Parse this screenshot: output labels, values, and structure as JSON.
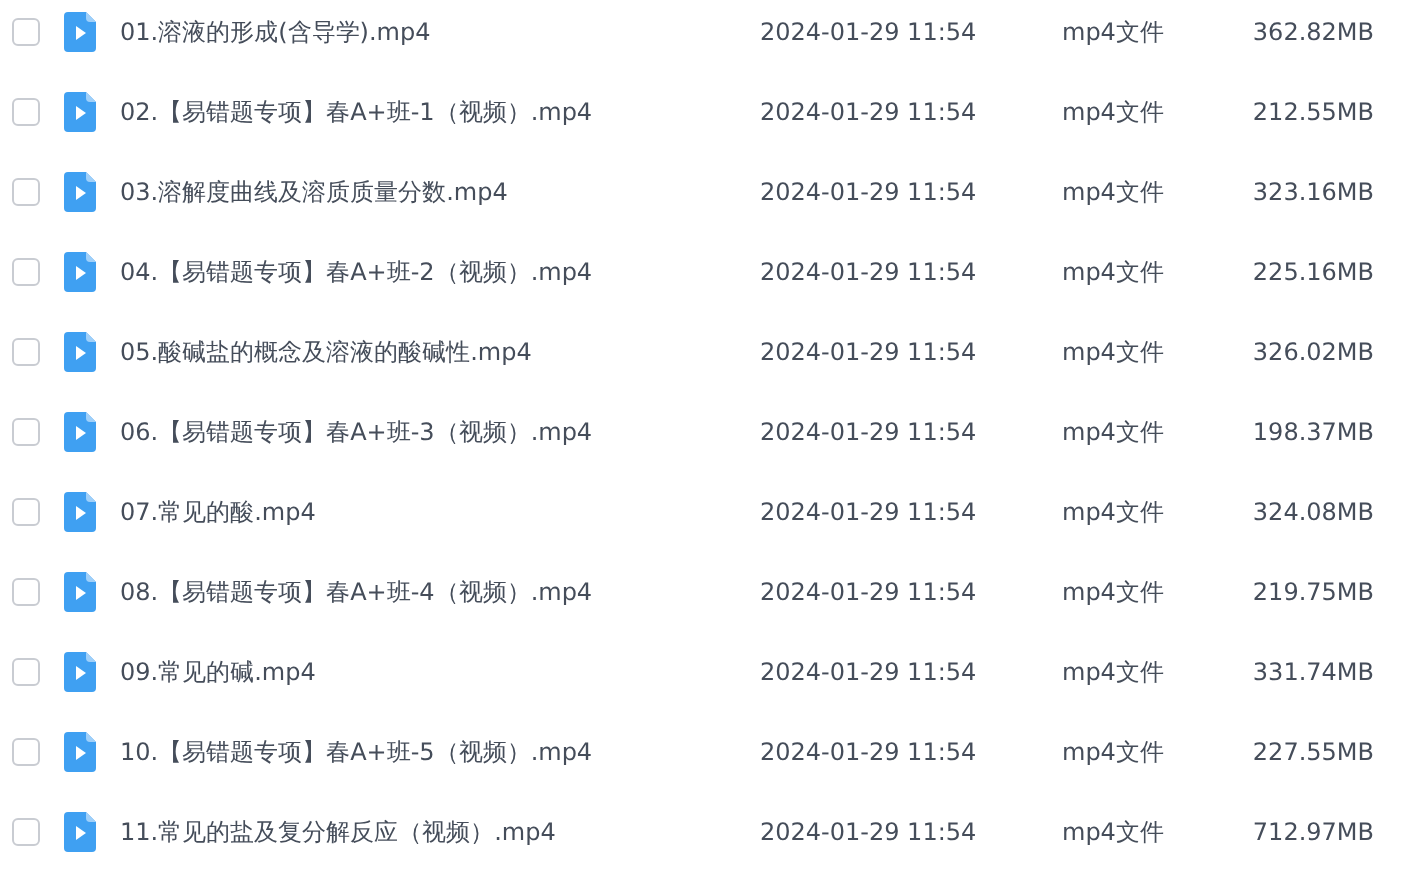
{
  "files": [
    {
      "name": "01.溶液的形成(含导学).mp4",
      "date": "2024-01-29 11:54",
      "type": "mp4文件",
      "size": "362.82MB",
      "checked": false
    },
    {
      "name": "02.【易错题专项】春A+班-1（视频）.mp4",
      "date": "2024-01-29 11:54",
      "type": "mp4文件",
      "size": "212.55MB",
      "checked": false
    },
    {
      "name": "03.溶解度曲线及溶质质量分数.mp4",
      "date": "2024-01-29 11:54",
      "type": "mp4文件",
      "size": "323.16MB",
      "checked": false
    },
    {
      "name": "04.【易错题专项】春A+班-2（视频）.mp4",
      "date": "2024-01-29 11:54",
      "type": "mp4文件",
      "size": "225.16MB",
      "checked": false
    },
    {
      "name": "05.酸碱盐的概念及溶液的酸碱性.mp4",
      "date": "2024-01-29 11:54",
      "type": "mp4文件",
      "size": "326.02MB",
      "checked": false
    },
    {
      "name": "06.【易错题专项】春A+班-3（视频）.mp4",
      "date": "2024-01-29 11:54",
      "type": "mp4文件",
      "size": "198.37MB",
      "checked": false
    },
    {
      "name": "07.常见的酸.mp4",
      "date": "2024-01-29 11:54",
      "type": "mp4文件",
      "size": "324.08MB",
      "checked": false
    },
    {
      "name": "08.【易错题专项】春A+班-4（视频）.mp4",
      "date": "2024-01-29 11:54",
      "type": "mp4文件",
      "size": "219.75MB",
      "checked": false
    },
    {
      "name": "09.常见的碱.mp4",
      "date": "2024-01-29 11:54",
      "type": "mp4文件",
      "size": "331.74MB",
      "checked": false
    },
    {
      "name": "10.【易错题专项】春A+班-5（视频）.mp4",
      "date": "2024-01-29 11:54",
      "type": "mp4文件",
      "size": "227.55MB",
      "checked": false
    },
    {
      "name": "11.常见的盐及复分解反应（视频）.mp4",
      "date": "2024-01-29 11:54",
      "type": "mp4文件",
      "size": "712.97MB",
      "checked": false
    }
  ]
}
